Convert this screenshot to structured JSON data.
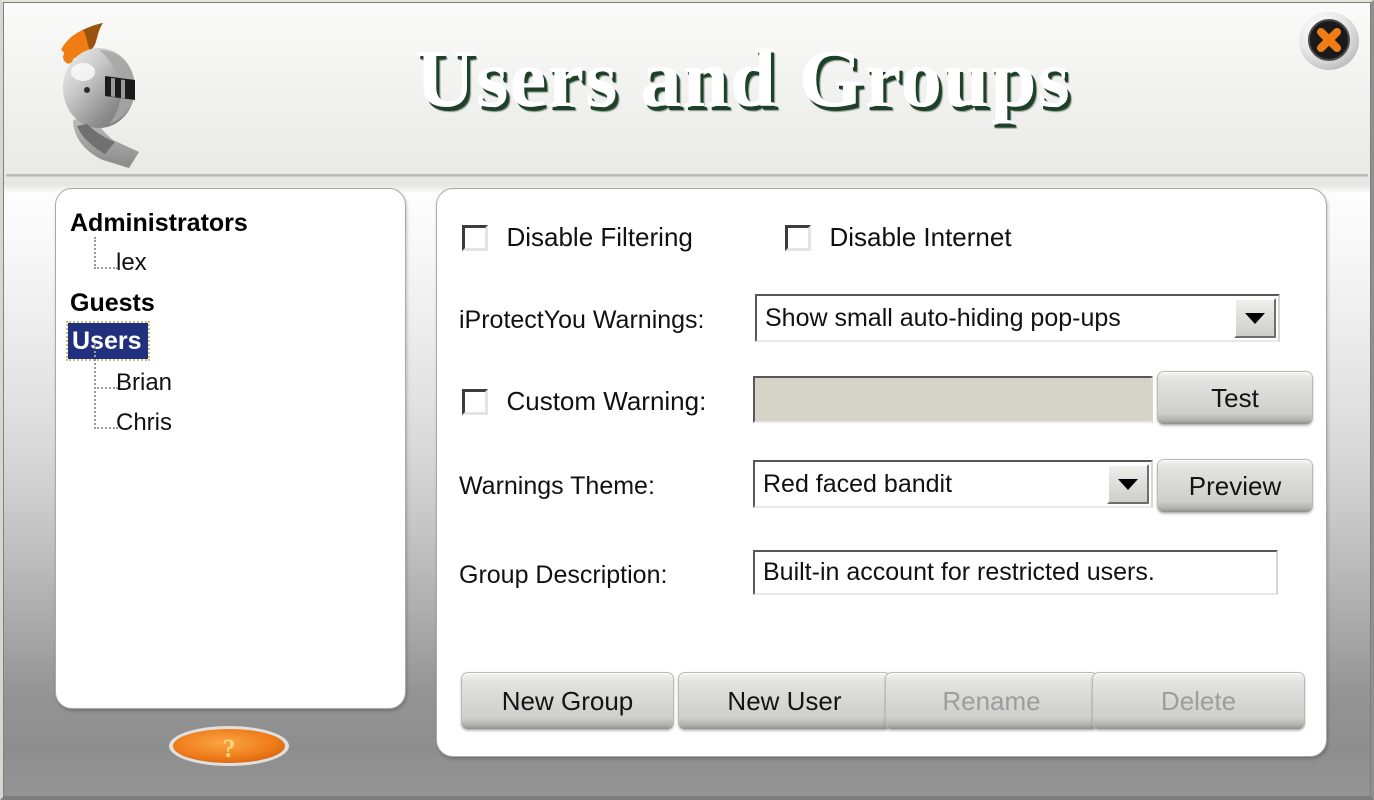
{
  "window": {
    "title": "Users and Groups",
    "logo_icon": "knight-helmet-icon",
    "close_icon": "close-x-icon",
    "help_icon": "question-mark-icon",
    "colors": {
      "title_text": "#ffffff",
      "title_shadow": "#1e4028",
      "selection": "#20307f",
      "accent_orange": "#ef7b1a",
      "disabled_text": "#9d9d9d"
    }
  },
  "tree": {
    "items": [
      {
        "label": "Administrators",
        "type": "group",
        "selected": false
      },
      {
        "label": "lex",
        "type": "user",
        "selected": false
      },
      {
        "label": "Guests",
        "type": "group",
        "selected": false
      },
      {
        "label": "Users",
        "type": "group",
        "selected": true
      },
      {
        "label": "Brian",
        "type": "user",
        "selected": false
      },
      {
        "label": "Chris",
        "type": "user",
        "selected": false
      }
    ]
  },
  "form": {
    "disable_filtering": {
      "label": "Disable Filtering",
      "checked": false
    },
    "disable_internet": {
      "label": "Disable Internet",
      "checked": false
    },
    "warnings": {
      "label": "iProtectYou Warnings:",
      "value": "Show small auto-hiding pop-ups"
    },
    "custom_warning": {
      "label": "Custom Warning:",
      "checked": false,
      "value": "",
      "enabled": false,
      "test_button": "Test"
    },
    "theme": {
      "label": "Warnings Theme:",
      "value": "Red faced bandit",
      "preview_button": "Preview"
    },
    "description": {
      "label": "Group Description:",
      "value": "Built-in account for restricted users."
    }
  },
  "actions": {
    "new_group": {
      "label": "New Group",
      "enabled": true
    },
    "new_user": {
      "label": "New User",
      "enabled": true
    },
    "rename": {
      "label": "Rename",
      "enabled": false
    },
    "delete": {
      "label": "Delete",
      "enabled": false
    }
  }
}
